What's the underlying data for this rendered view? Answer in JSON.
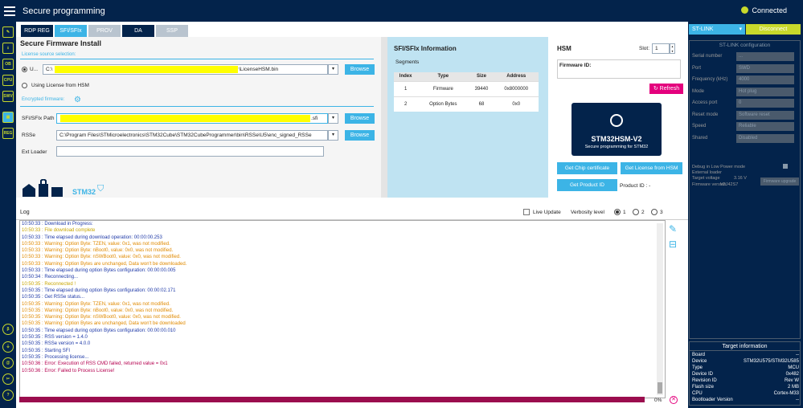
{
  "app": {
    "title": "Secure programming",
    "status": "Connected"
  },
  "leftbar": {
    "icons": [
      {
        "name": "edit-icon",
        "glyph": "✎"
      },
      {
        "name": "download-icon",
        "glyph": "⭳"
      },
      {
        "name": "ob-icon",
        "glyph": "OB"
      },
      {
        "name": "cpu-icon",
        "glyph": "CPU"
      },
      {
        "name": "swv-icon",
        "glyph": "SWV"
      },
      {
        "name": "secure-icon",
        "glyph": "▣"
      },
      {
        "name": "reg-icon",
        "glyph": "REG"
      },
      {
        "name": "beta-icon",
        "glyph": "β"
      },
      {
        "name": "plug-icon",
        "glyph": "⏚"
      },
      {
        "name": "link-icon",
        "glyph": "@"
      },
      {
        "name": "tool-icon",
        "glyph": "✂"
      },
      {
        "name": "help-icon",
        "glyph": "?"
      }
    ]
  },
  "tabs": [
    {
      "label": "RDP REG",
      "bg": "#03234b"
    },
    {
      "label": "SFI/SFIx",
      "bg": "#3cb4e6"
    },
    {
      "label": "PROV",
      "bg": "#b9c4cf"
    },
    {
      "label": "DA",
      "bg": "#03234b"
    },
    {
      "label": "SSP",
      "bg": "#b9c4cf"
    }
  ],
  "firmware": {
    "title": "Secure Firmware Install",
    "license_source": "License source selection:",
    "radio1": "U...",
    "license_path": "C:\\",
    "license_file": "\\LicenseHSM.bin",
    "browse": "Browse",
    "radio2": "Using License from HSM",
    "encrypted": "Encrypted firmware:",
    "sfi_label": "SFI/SFIx Path",
    "sfi_ext": ".sfi",
    "rsse_label": "RSSe",
    "rsse_path": "C:\\Program Files\\STMicroelectronics\\STM32Cube\\STM32CubeProgrammer\\bin\\RSSe\\U5\\enc_signed_RSSe",
    "extloader_label": "Ext Loader",
    "logo_text": "STM32"
  },
  "sfi_info": {
    "title": "SFI/SFIx Information",
    "segments": "Segments",
    "headers": [
      "Index",
      "Type",
      "Size",
      "Address"
    ],
    "rows": [
      [
        "1",
        "Firmware",
        "39440",
        "0x8000000"
      ],
      [
        "2",
        "Option Bytes",
        "68",
        "0x0"
      ]
    ]
  },
  "hsm": {
    "title": "HSM",
    "slot_label": "Slot:",
    "slot": "1",
    "fw_id": "Firmware ID:",
    "refresh": "Refresh",
    "card_name": "STM32HSM-V2",
    "card_sub": "Secure programming for STM32",
    "chip_cert": "Get Chip certificate",
    "license": "Get License from HSM",
    "product_id": "Get Product ID",
    "product_label": "Product ID : -"
  },
  "log": {
    "title": "Log",
    "live": "Live Update",
    "verbosity": "Verbosity level",
    "levels": [
      "1",
      "2",
      "3"
    ],
    "percent": "0%",
    "lines": [
      {
        "t": "10:50:33 : Download in Progress:",
        "c": "#1f3aa8"
      },
      {
        "t": "10:50:33 : File download complete",
        "c": "#c8a600"
      },
      {
        "t": "10:50:33 : Time elapsed during download operation: 00:00:00.253",
        "c": "#1f3aa8"
      },
      {
        "t": "10:50:33 : Warning: Option Byte: TZEN, value: 0x1, was not modified.",
        "c": "#e08a00"
      },
      {
        "t": "10:50:33 : Warning: Option Byte: nBoot0, value: 0x0, was not modified.",
        "c": "#e08a00"
      },
      {
        "t": "10:50:33 : Warning: Option Byte: nSWBoot0, value: 0x0, was not modified.",
        "c": "#e08a00"
      },
      {
        "t": "10:50:33 : Warning: Option Bytes are unchanged, Data won't be downloaded.",
        "c": "#e08a00"
      },
      {
        "t": "10:50:33 : Time elapsed during option Bytes configuration: 00:00:00.005",
        "c": "#1f3aa8"
      },
      {
        "t": "10:50:34 : Reconnecting...",
        "c": "#1f3aa8"
      },
      {
        "t": "10:50:35 : Reconnected !",
        "c": "#c8a600"
      },
      {
        "t": "10:50:35 : Time elapsed during option Bytes configuration: 00:00:02.171",
        "c": "#1f3aa8"
      },
      {
        "t": "10:50:35 : Get RSSe status...",
        "c": "#1f3aa8"
      },
      {
        "t": "10:50:35 : Warning: Option Byte: TZEN, value: 0x1, was not modified.",
        "c": "#e08a00"
      },
      {
        "t": "10:50:35 : Warning: Option Byte: nBoot0, value: 0x0, was not modified.",
        "c": "#e08a00"
      },
      {
        "t": "10:50:35 : Warning: Option Byte: nSWBoot0, value: 0x0, was not modified.",
        "c": "#e08a00"
      },
      {
        "t": "10:50:35 : Warning: Option Bytes are unchanged, Data won't be downloaded",
        "c": "#e08a00"
      },
      {
        "t": "10:50:35 : Time elapsed during option Bytes configuration: 00:00:00.010",
        "c": "#1f3aa8"
      },
      {
        "t": "10:50:35 : RSS version = 1.4.0",
        "c": "#1f3aa8"
      },
      {
        "t": "10:50:35 : RSSe version = 4.0.0",
        "c": "#1f3aa8"
      },
      {
        "t": "10:50:35 : Starting SFI",
        "c": "#1f3aa8"
      },
      {
        "t": "10:50:35 : Processing license...",
        "c": "#1f3aa8"
      },
      {
        "t": "10:50:36 : Error: Execution of RSS CMD failed, returned value = 0x1",
        "c": "#b5004f"
      },
      {
        "t": "10:50:36 : Error: Failed to Process License!",
        "c": "#b5004f"
      }
    ]
  },
  "stlink": {
    "selector": "ST-LINK",
    "disconnect": "Disconnect",
    "config_title": "ST-LINK configuration",
    "rows": [
      {
        "k": "Serial number",
        "v": "..."
      },
      {
        "k": "Port",
        "v": "SWD"
      },
      {
        "k": "Frequency (kHz)",
        "v": "4000"
      },
      {
        "k": "Mode",
        "v": "Hot plug"
      },
      {
        "k": "Access port",
        "v": "0"
      },
      {
        "k": "Reset mode",
        "v": "Software reset"
      },
      {
        "k": "Speed",
        "v": "Reliable"
      },
      {
        "k": "Shared",
        "v": "Disabled"
      }
    ],
    "debug_lp": "Debug in Low Power mode",
    "ext_loader": "External loader",
    "target_voltage": "Target voltage",
    "target_voltage_v": "3.16 V",
    "fw_version": "Firmware version",
    "fw_version_v": "V2J42S7",
    "fw_upgrade": "Firmware upgrade"
  },
  "target": {
    "title": "Target information",
    "rows": [
      {
        "k": "Board",
        "v": "--"
      },
      {
        "k": "Device",
        "v": "STM32U575/STM32U585"
      },
      {
        "k": "Type",
        "v": "MCU"
      },
      {
        "k": "Device ID",
        "v": "0x482"
      },
      {
        "k": "Revision ID",
        "v": "Rev W"
      },
      {
        "k": "Flash size",
        "v": "2 MB"
      },
      {
        "k": "CPU",
        "v": "Cortex-M33"
      },
      {
        "k": "Bootloader Version",
        "v": "--"
      }
    ]
  },
  "colors": {
    "navy": "#03234b",
    "accent": "#3cb4e6",
    "lime": "#c8d92b",
    "pink": "#e4007d",
    "progress": "#9b0d4e"
  }
}
